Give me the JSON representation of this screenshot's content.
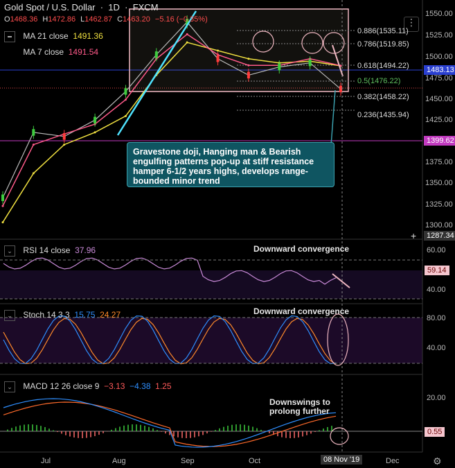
{
  "header": {
    "symbol": "Gold Spot / U.S. Dollar",
    "interval": "1D",
    "source": "FXCM",
    "ohlc": [
      {
        "k": "O",
        "v": "1468.36"
      },
      {
        "k": "H",
        "v": "1472.86"
      },
      {
        "k": "L",
        "v": "1462.87"
      },
      {
        "k": "C",
        "v": "1463.20"
      }
    ],
    "change": "−5.16 (−0.35%)"
  },
  "ma": [
    {
      "label": "MA 21 close",
      "value": "1491.36",
      "color": "#f0e040"
    },
    {
      "label": "MA 7 close",
      "value": "1491.54",
      "color": "#ff5a8a"
    }
  ],
  "price_axis": {
    "ticks": [
      "1550.00",
      "1525.00",
      "1500.00",
      "1475.00",
      "1450.00",
      "1425.00",
      "1400.00",
      "1375.00",
      "1350.00",
      "1325.00",
      "1300.00"
    ]
  },
  "price_tags": [
    {
      "value": "1483.13",
      "color": "#2a3fd0"
    },
    {
      "value": "1399.62",
      "color": "#c23ac0"
    },
    {
      "value": "1287.34",
      "color": "#333333"
    }
  ],
  "fib_levels": [
    {
      "label": "0.886(1535.11)",
      "color": "#dddddd"
    },
    {
      "label": "0.786(1519.85)",
      "color": "#dddddd"
    },
    {
      "label": "0.618(1494.22)",
      "color": "#dddddd"
    },
    {
      "label": "0.5(1476.22)",
      "color": "#5fbf5f"
    },
    {
      "label": "0.382(1458.22)",
      "color": "#dddddd"
    },
    {
      "label": "0.236(1435.94)",
      "color": "#dddddd"
    }
  ],
  "callout": "Gravestone doji, Hanging man & Bearish engulfing patterns pop-up at stiff resistance hamper 6-1/2 years highs, develops range-bounded minor trend",
  "rsi": {
    "title": "RSI 14 close",
    "value": "37.96",
    "tag": "59.14",
    "ticks": [
      "60.00",
      "40.00"
    ],
    "note": "Downward convergence"
  },
  "stoch": {
    "title": "Stoch 14 3 3",
    "k": "15.75",
    "d": "24.27",
    "ticks": [
      "80.00",
      "40.00"
    ],
    "note": "Downward convergence"
  },
  "macd": {
    "title": "MACD 12 26 close 9",
    "macd": "−3.13",
    "signal": "−4.38",
    "hist": "1.25",
    "ticks": [
      "20.00",
      "0.00"
    ],
    "tag": "0.55",
    "note1": "Downswings to",
    "note2": "prolong further"
  },
  "time_axis": {
    "labels": [
      "Jul",
      "Aug",
      "Sep",
      "Oct",
      "Dec"
    ],
    "cursor_date": "08 Nov '19"
  },
  "chart_data": {
    "type": "line",
    "title": "Gold Spot / U.S. Dollar 1D FXCM",
    "xlabel": "",
    "ylabel": "",
    "x": [
      "Jun 10",
      "Jun 24",
      "Jul 8",
      "Jul 22",
      "Aug 5",
      "Aug 19",
      "Sep 2",
      "Sep 16",
      "Sep 30",
      "Oct 14",
      "Oct 28",
      "Nov 8"
    ],
    "ylim": [
      1287,
      1560
    ],
    "series": [
      {
        "name": "",
        "values": [
          1330,
          1410,
          1405,
          1425,
          1460,
          1505,
          1545,
          1500,
          1480,
          1490,
          1495,
          1463
        ]
      },
      {
        "name": "MA 21 close",
        "values": [
          1300,
          1360,
          1395,
          1410,
          1430,
          1480,
          1520,
          1510,
          1500,
          1495,
          1497,
          1491.36
        ]
      },
      {
        "name": "MA 7 close",
        "values": [
          1320,
          1395,
          1408,
          1420,
          1450,
          1500,
          1530,
          1505,
          1492,
          1492,
          1500,
          1491.54
        ]
      }
    ]
  }
}
